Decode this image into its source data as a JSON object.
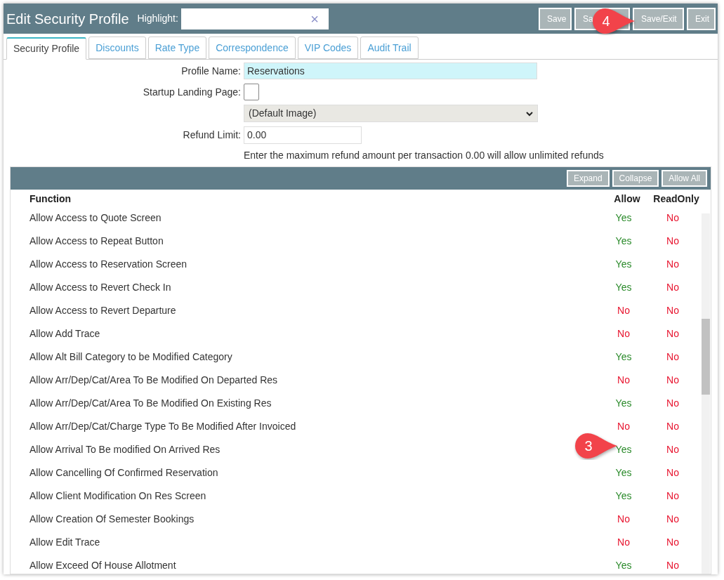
{
  "window": {
    "title": "Edit Security Profile"
  },
  "highlight": {
    "label": "Highlight:",
    "clear": "×"
  },
  "buttons": [
    "Save",
    "Sa",
    "Save/Exit",
    "Exit"
  ],
  "tabs": [
    {
      "label": "Security Profile",
      "selected": true
    },
    {
      "label": "Discounts",
      "selected": false
    },
    {
      "label": "Rate Type",
      "selected": false
    },
    {
      "label": "Correspondence",
      "selected": false
    },
    {
      "label": "VIP Codes",
      "selected": false
    },
    {
      "label": "Audit Trail",
      "selected": false
    }
  ],
  "form": {
    "profile_name": {
      "label": "Profile Name:",
      "value": "Reservations"
    },
    "startup_landing_page": {
      "label": "Startup Landing Page:",
      "checked": false,
      "image": "(Default Image)"
    },
    "refund_limit": {
      "label": "Refund Limit:",
      "value": "0.00",
      "hint": "Enter the maximum refund amount per transaction 0.00 will allow unlimited refunds"
    }
  },
  "table_actions": [
    "Expand",
    "Collapse",
    "Allow All"
  ],
  "table": {
    "columns": [
      "Function",
      "Allow",
      "ReadOnly"
    ],
    "rows": [
      {
        "function": "Allow Access to Quote Screen",
        "allow": {
          "text": "Yes",
          "on": true
        },
        "read_only": {
          "text": "No",
          "on": false
        }
      },
      {
        "function": "Allow Access to Repeat Button",
        "allow": {
          "text": "Yes",
          "on": true
        },
        "read_only": {
          "text": "No",
          "on": false
        }
      },
      {
        "function": "Allow Access to Reservation Screen",
        "allow": {
          "text": "Yes",
          "on": true
        },
        "read_only": {
          "text": "No",
          "on": false
        }
      },
      {
        "function": "Allow Access to Revert Check In",
        "allow": {
          "text": "Yes",
          "on": true
        },
        "read_only": {
          "text": "No",
          "on": false
        }
      },
      {
        "function": "Allow Access to Revert Departure",
        "allow": {
          "text": "No",
          "on": false
        },
        "read_only": {
          "text": "No",
          "on": false
        }
      },
      {
        "function": "Allow Add Trace",
        "allow": {
          "text": "No",
          "on": false
        },
        "read_only": {
          "text": "No",
          "on": false
        }
      },
      {
        "function": "Allow Alt Bill Category to be Modified Category",
        "allow": {
          "text": "Yes",
          "on": true
        },
        "read_only": {
          "text": "No",
          "on": false
        }
      },
      {
        "function": "Allow Arr/Dep/Cat/Area To Be Modified On Departed Res",
        "allow": {
          "text": "No",
          "on": false
        },
        "read_only": {
          "text": "No",
          "on": false
        }
      },
      {
        "function": "Allow Arr/Dep/Cat/Area To Be Modified On Existing Res",
        "allow": {
          "text": "Yes",
          "on": true
        },
        "read_only": {
          "text": "No",
          "on": false
        }
      },
      {
        "function": "Allow Arr/Dep/Cat/Charge Type To Be Modified After Invoiced",
        "allow": {
          "text": "No",
          "on": false
        },
        "read_only": {
          "text": "No",
          "on": false
        }
      },
      {
        "function": "Allow Arrival To Be modified On Arrived Res",
        "allow": {
          "text": "Yes",
          "on": true
        },
        "read_only": {
          "text": "No",
          "on": false
        }
      },
      {
        "function": "Allow Cancelling Of Confirmed Reservation",
        "allow": {
          "text": "Yes",
          "on": true
        },
        "read_only": {
          "text": "No",
          "on": false
        }
      },
      {
        "function": "Allow Client Modification On Res Screen",
        "allow": {
          "text": "Yes",
          "on": true
        },
        "read_only": {
          "text": "No",
          "on": false
        }
      },
      {
        "function": "Allow Creation Of Semester Bookings",
        "allow": {
          "text": "No",
          "on": false
        },
        "read_only": {
          "text": "No",
          "on": false
        }
      },
      {
        "function": "Allow Edit Trace",
        "allow": {
          "text": "No",
          "on": false
        },
        "read_only": {
          "text": "No",
          "on": false
        }
      },
      {
        "function": "Allow Exceed Of House Allotment",
        "allow": {
          "text": "Yes",
          "on": true
        },
        "read_only": {
          "text": "No",
          "on": false
        }
      }
    ]
  },
  "callouts": [
    {
      "number": "4"
    },
    {
      "number": "3"
    }
  ]
}
